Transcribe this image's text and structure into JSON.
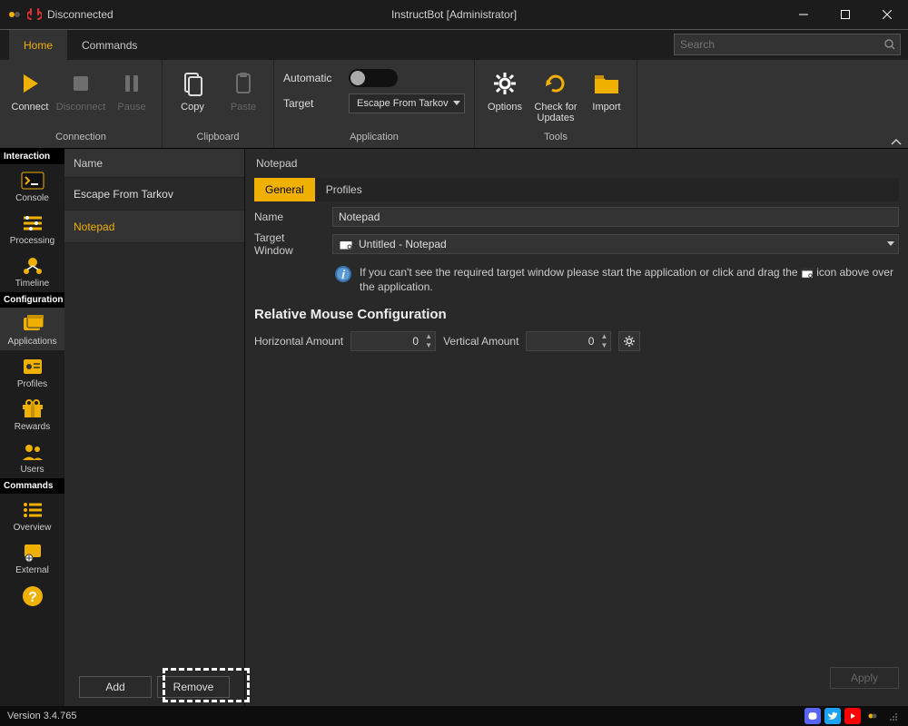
{
  "titlebar": {
    "status": "Disconnected",
    "title": "InstructBot [Administrator]"
  },
  "menu": {
    "tabs": [
      "Home",
      "Commands"
    ],
    "search_placeholder": "Search"
  },
  "ribbon": {
    "connection": {
      "label": "Connection",
      "connect": "Connect",
      "disconnect": "Disconnect",
      "pause": "Pause"
    },
    "clipboard": {
      "label": "Clipboard",
      "copy": "Copy",
      "paste": "Paste"
    },
    "application": {
      "label": "Application",
      "automatic": "Automatic",
      "target": "Target",
      "target_value": "Escape From Tarkov"
    },
    "tools": {
      "label": "Tools",
      "options": "Options",
      "check": "Check for\nUpdates",
      "import": "Import"
    }
  },
  "sidebar": {
    "cats": {
      "interaction": "Interaction",
      "configuration": "Configuration",
      "commands": "Commands"
    },
    "items": {
      "console": "Console",
      "processing": "Processing",
      "timeline": "Timeline",
      "applications": "Applications",
      "profiles": "Profiles",
      "rewards": "Rewards",
      "users": "Users",
      "overview": "Overview",
      "external": "External",
      "help": "Help"
    }
  },
  "list": {
    "header": "Name",
    "items": [
      "Escape From Tarkov",
      "Notepad"
    ],
    "add": "Add",
    "remove": "Remove"
  },
  "editor": {
    "title": "Notepad",
    "tabs": [
      "General",
      "Profiles"
    ],
    "name_label": "Name",
    "name_value": "Notepad",
    "target_label": "Target Window",
    "target_value": "Untitled - Notepad",
    "info_pre": "If you can't see the required target window please start the application or click and drag the ",
    "info_post": " icon above over the application.",
    "section": "Relative Mouse Configuration",
    "hamount_label": "Horizontal Amount",
    "hamount_value": "0",
    "vamount_label": "Vertical Amount",
    "vamount_value": "0",
    "apply": "Apply"
  },
  "status": {
    "version": "Version 3.4.765"
  }
}
